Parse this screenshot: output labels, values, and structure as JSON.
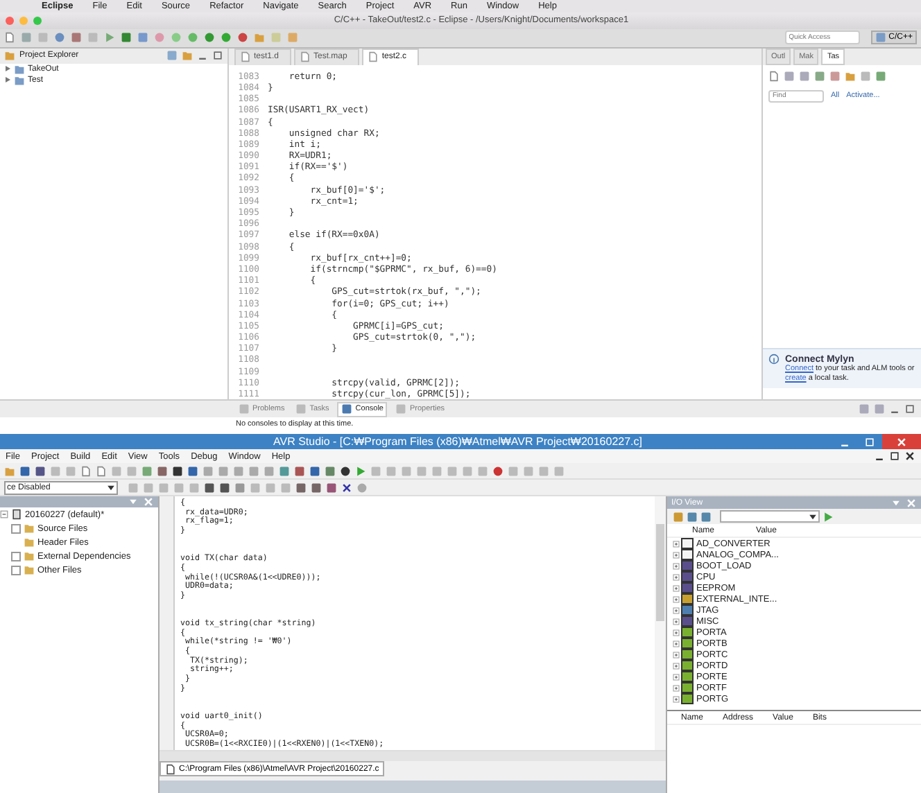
{
  "mac_menu_bar": {
    "items": [
      "Eclipse",
      "File",
      "Edit",
      "Source",
      "Refactor",
      "Navigate",
      "Search",
      "Project",
      "AVR",
      "Run",
      "Window",
      "Help"
    ]
  },
  "eclipse": {
    "title": "C/C++ - TakeOut/test2.c - Eclipse - /Users/Knight/Documents/workspace1",
    "quick_access": {
      "placeholder": "Quick Access"
    },
    "perspective": "C/C++",
    "project_explorer": {
      "title": "Project Explorer",
      "items": [
        {
          "label": "TakeOut",
          "expanded": false
        },
        {
          "label": "Test",
          "expanded": false
        }
      ]
    },
    "editor": {
      "tabs": [
        {
          "label": "test1.d",
          "selected": false
        },
        {
          "label": "Test.map",
          "selected": false
        },
        {
          "label": "test2.c",
          "selected": true
        }
      ],
      "lines": [
        {
          "n": "1083",
          "text": "    return 0;"
        },
        {
          "n": "1084",
          "text": "}"
        },
        {
          "n": "1085"
        },
        {
          "n": "1086",
          "text": "ISR(USART1_RX_vect)"
        },
        {
          "n": "1087",
          "text": "{"
        },
        {
          "n": "1088",
          "text": "    unsigned char RX;"
        },
        {
          "n": "1089",
          "text": "    int i;"
        },
        {
          "n": "1090",
          "text": "    RX=UDR1;"
        },
        {
          "n": "1091",
          "text": "    if(RX=='$')"
        },
        {
          "n": "1092",
          "text": "    {"
        },
        {
          "n": "1093",
          "text": "        rx_buf[0]='$';"
        },
        {
          "n": "1094",
          "text": "        rx_cnt=1;"
        },
        {
          "n": "1095",
          "text": "    }"
        },
        {
          "n": "1096"
        },
        {
          "n": "1097",
          "text": "    else if(RX==0x0A)"
        },
        {
          "n": "1098",
          "text": "    {"
        },
        {
          "n": "1099",
          "text": "        rx_buf[rx_cnt++]=0;"
        },
        {
          "n": "1100",
          "text": "        if(strncmp(\"$GPRMC\", rx_buf, 6)==0)"
        },
        {
          "n": "1101",
          "text": "        {"
        },
        {
          "n": "1102",
          "text": "            GPS_cut=strtok(rx_buf, \",\");"
        },
        {
          "n": "1103",
          "text": "            for(i=0; GPS_cut; i++)"
        },
        {
          "n": "1104",
          "text": "            {"
        },
        {
          "n": "1105",
          "text": "                GPRMC[i]=GPS_cut;"
        },
        {
          "n": "1106",
          "text": "                GPS_cut=strtok(0, \",\");"
        },
        {
          "n": "1107",
          "text": "            }"
        },
        {
          "n": "1108"
        },
        {
          "n": "1109"
        },
        {
          "n": "1110",
          "text": "            strcpy(valid, GPRMC[2]);"
        },
        {
          "n": "1111",
          "text": "            strcpy(cur_lon, GPRMC[5]);"
        }
      ]
    },
    "side_panel": {
      "tabs": [
        {
          "label": "Outl",
          "selected": false
        },
        {
          "label": "Mak",
          "selected": false
        },
        {
          "label": "Tas",
          "selected": true
        }
      ],
      "find": {
        "placeholder": "Find"
      },
      "links": [
        "All",
        "Activate..."
      ],
      "mylyn": {
        "title": "Connect Mylyn",
        "parts": [
          {
            "kind": "link",
            "text": "Connect"
          },
          {
            "kind": "text",
            "text": " to your task and ALM tools or "
          },
          {
            "kind": "link",
            "text": "create"
          },
          {
            "kind": "text",
            "text": " a local task."
          }
        ]
      }
    },
    "console": {
      "tabs": [
        {
          "label": "Problems",
          "selected": false
        },
        {
          "label": "Tasks",
          "selected": false
        },
        {
          "label": "Console",
          "selected": true
        },
        {
          "label": "Properties",
          "selected": false
        }
      ],
      "message": "No consoles to display at this time."
    }
  },
  "avr_studio": {
    "title": "AVR Studio - [C:₩Program Files (x86)₩Atmel₩AVR Project₩20160227.c]",
    "menu": [
      "File",
      "Project",
      "Build",
      "Edit",
      "View",
      "Tools",
      "Debug",
      "Window",
      "Help"
    ],
    "config_dropdown": "ce Disabled",
    "project_tree": [
      {
        "label": "20160227 (default)*",
        "expanded": true,
        "children": [
          {
            "label": "Source Files",
            "expander": true
          },
          {
            "label": "Header Files",
            "expander": false
          },
          {
            "label": "External Dependencies",
            "expander": true
          },
          {
            "label": "Other Files",
            "expander": true
          }
        ]
      }
    ],
    "editor": {
      "blocks": [
        [
          "{",
          " rx_data=UDR0;",
          " rx_flag=1;",
          "}"
        ],
        [
          "void TX(char data)",
          "{",
          " while(!(UCSR0A&(1<<UDRE0)));",
          " UDR0=data;",
          "}"
        ],
        [
          "void tx_string(char *string)",
          "{",
          " while(*string != '₩0')",
          " {",
          "  TX(*string);",
          "  string++;",
          " }",
          "}"
        ],
        [
          "void uart0_init()",
          "{",
          " UCSR0A=0;",
          " UCSR0B=(1<<RXCIE0)|(1<<RXEN0)|(1<<TXEN0);"
        ]
      ],
      "file_tab": "C:\\Program Files (x86)\\Atmel\\AVR Project\\20160227.c"
    },
    "io_view": {
      "title": "I/O View",
      "columns": [
        "Name",
        "Value"
      ],
      "items": [
        {
          "label": "AD_CONVERTER",
          "color": "#f4f4f4"
        },
        {
          "label": "ANALOG_COMPA...",
          "color": "#f4f4f4"
        },
        {
          "label": "BOOT_LOAD",
          "color": "#5a4f8c"
        },
        {
          "label": "CPU",
          "color": "#5a4f8c"
        },
        {
          "label": "EEPROM",
          "color": "#5a4f8c"
        },
        {
          "label": "EXTERNAL_INTE...",
          "color": "#c8a030"
        },
        {
          "label": "JTAG",
          "color": "#4f7fb0"
        },
        {
          "label": "MISC",
          "color": "#5a4f8c"
        },
        {
          "label": "PORTA",
          "color": "#7ab030"
        },
        {
          "label": "PORTB",
          "color": "#7ab030"
        },
        {
          "label": "PORTC",
          "color": "#7ab030"
        },
        {
          "label": "PORTD",
          "color": "#7ab030"
        },
        {
          "label": "PORTE",
          "color": "#7ab030"
        },
        {
          "label": "PORTF",
          "color": "#7ab030"
        },
        {
          "label": "PORTG",
          "color": "#7ab030"
        }
      ],
      "detail_columns": [
        "Name",
        "Address",
        "Value",
        "Bits"
      ]
    }
  }
}
